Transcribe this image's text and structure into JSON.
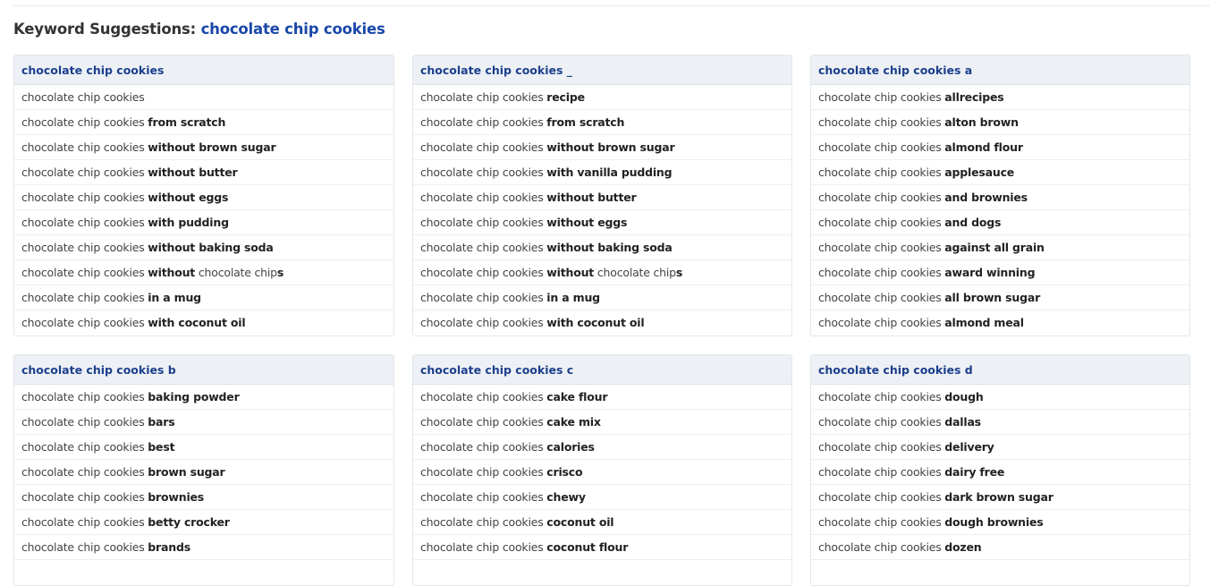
{
  "title_prefix": "Keyword Suggestions:",
  "query": "chocolate chip cookies",
  "groups": [
    {
      "header": "chocolate chip cookies",
      "items": [
        [
          [
            "chocolate chip cookies",
            0
          ]
        ],
        [
          [
            "chocolate chip cookies ",
            0
          ],
          [
            "from scratch",
            1
          ]
        ],
        [
          [
            "chocolate chip cookies ",
            0
          ],
          [
            "without brown sugar",
            1
          ]
        ],
        [
          [
            "chocolate chip cookies ",
            0
          ],
          [
            "without butter",
            1
          ]
        ],
        [
          [
            "chocolate chip cookies ",
            0
          ],
          [
            "without eggs",
            1
          ]
        ],
        [
          [
            "chocolate chip cookies ",
            0
          ],
          [
            "with pudding",
            1
          ]
        ],
        [
          [
            "chocolate chip cookies ",
            0
          ],
          [
            "without baking soda",
            1
          ]
        ],
        [
          [
            "chocolate chip cookies ",
            0
          ],
          [
            "without",
            1
          ],
          [
            " chocolate chip",
            0
          ],
          [
            "s",
            1
          ]
        ],
        [
          [
            "chocolate chip cookies ",
            0
          ],
          [
            "in a mug",
            1
          ]
        ],
        [
          [
            "chocolate chip cookies ",
            0
          ],
          [
            "with coconut oil",
            1
          ]
        ]
      ]
    },
    {
      "header": "chocolate chip cookies _",
      "items": [
        [
          [
            "chocolate chip cookies ",
            0
          ],
          [
            "recipe",
            1
          ]
        ],
        [
          [
            "chocolate chip cookies ",
            0
          ],
          [
            "from scratch",
            1
          ]
        ],
        [
          [
            "chocolate chip cookies ",
            0
          ],
          [
            "without brown sugar",
            1
          ]
        ],
        [
          [
            "chocolate chip cookies ",
            0
          ],
          [
            "with vanilla pudding",
            1
          ]
        ],
        [
          [
            "chocolate chip cookies ",
            0
          ],
          [
            "without butter",
            1
          ]
        ],
        [
          [
            "chocolate chip cookies ",
            0
          ],
          [
            "without eggs",
            1
          ]
        ],
        [
          [
            "chocolate chip cookies ",
            0
          ],
          [
            "without baking soda",
            1
          ]
        ],
        [
          [
            "chocolate chip cookies ",
            0
          ],
          [
            "without",
            1
          ],
          [
            " chocolate chip",
            0
          ],
          [
            "s",
            1
          ]
        ],
        [
          [
            "chocolate chip cookies ",
            0
          ],
          [
            "in a mug",
            1
          ]
        ],
        [
          [
            "chocolate chip cookies ",
            0
          ],
          [
            "with coconut oil",
            1
          ]
        ]
      ]
    },
    {
      "header": "chocolate chip cookies a",
      "items": [
        [
          [
            "chocolate chip cookies ",
            0
          ],
          [
            "allrecipes",
            1
          ]
        ],
        [
          [
            "chocolate chip cookies ",
            0
          ],
          [
            "alton brown",
            1
          ]
        ],
        [
          [
            "chocolate chip cookies ",
            0
          ],
          [
            "almond flour",
            1
          ]
        ],
        [
          [
            "chocolate chip cookies ",
            0
          ],
          [
            "applesauce",
            1
          ]
        ],
        [
          [
            "chocolate chip cookies ",
            0
          ],
          [
            "and brownies",
            1
          ]
        ],
        [
          [
            "chocolate chip cookies ",
            0
          ],
          [
            "and dogs",
            1
          ]
        ],
        [
          [
            "chocolate chip cookies ",
            0
          ],
          [
            "against all grain",
            1
          ]
        ],
        [
          [
            "chocolate chip cookies ",
            0
          ],
          [
            "award winning",
            1
          ]
        ],
        [
          [
            "chocolate chip cookies ",
            0
          ],
          [
            "all brown sugar",
            1
          ]
        ],
        [
          [
            "chocolate chip cookies ",
            0
          ],
          [
            "almond meal",
            1
          ]
        ]
      ]
    },
    {
      "header": "chocolate chip cookies b",
      "items": [
        [
          [
            "chocolate chip cookies ",
            0
          ],
          [
            "baking powder",
            1
          ]
        ],
        [
          [
            "chocolate chip cookies ",
            0
          ],
          [
            "bars",
            1
          ]
        ],
        [
          [
            "chocolate chip cookies ",
            0
          ],
          [
            "best",
            1
          ]
        ],
        [
          [
            "chocolate chip cookies ",
            0
          ],
          [
            "brown sugar",
            1
          ]
        ],
        [
          [
            "chocolate chip cookies ",
            0
          ],
          [
            "brownies",
            1
          ]
        ],
        [
          [
            "chocolate chip cookies ",
            0
          ],
          [
            "betty crocker",
            1
          ]
        ],
        [
          [
            "chocolate chip cookies ",
            0
          ],
          [
            "brands",
            1
          ]
        ]
      ]
    },
    {
      "header": "chocolate chip cookies c",
      "items": [
        [
          [
            "chocolate chip cookies ",
            0
          ],
          [
            "cake flour",
            1
          ]
        ],
        [
          [
            "chocolate chip cookies ",
            0
          ],
          [
            "cake mix",
            1
          ]
        ],
        [
          [
            "chocolate chip cookies ",
            0
          ],
          [
            "calories",
            1
          ]
        ],
        [
          [
            "chocolate chip cookies ",
            0
          ],
          [
            "crisco",
            1
          ]
        ],
        [
          [
            "chocolate chip cookies ",
            0
          ],
          [
            "chewy",
            1
          ]
        ],
        [
          [
            "chocolate chip cookies ",
            0
          ],
          [
            "coconut oil",
            1
          ]
        ],
        [
          [
            "chocolate chip cookies ",
            0
          ],
          [
            "coconut flour",
            1
          ]
        ]
      ]
    },
    {
      "header": "chocolate chip cookies d",
      "items": [
        [
          [
            "chocolate chip cookies ",
            0
          ],
          [
            "dough",
            1
          ]
        ],
        [
          [
            "chocolate chip cookies ",
            0
          ],
          [
            "dallas",
            1
          ]
        ],
        [
          [
            "chocolate chip cookies ",
            0
          ],
          [
            "delivery",
            1
          ]
        ],
        [
          [
            "chocolate chip cookies ",
            0
          ],
          [
            "dairy free",
            1
          ]
        ],
        [
          [
            "chocolate chip cookies ",
            0
          ],
          [
            "dark brown sugar",
            1
          ]
        ],
        [
          [
            "chocolate chip cookies ",
            0
          ],
          [
            "dough brownies",
            1
          ]
        ],
        [
          [
            "chocolate chip cookies ",
            0
          ],
          [
            "dozen",
            1
          ]
        ]
      ]
    }
  ]
}
